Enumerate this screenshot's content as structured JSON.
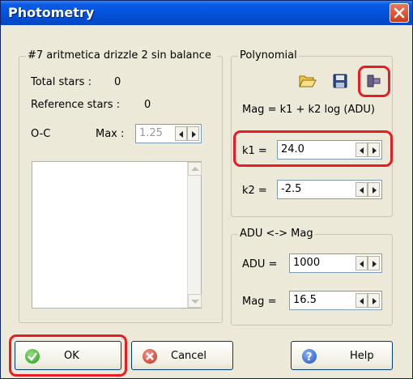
{
  "window": {
    "title": "Photometry"
  },
  "left_group": {
    "title": "#7 aritmetica drizzle 2 sin balance",
    "total_stars_label": "Total stars :",
    "total_stars_value": "0",
    "reference_stars_label": "Reference stars :",
    "reference_stars_value": "0",
    "oc_label": "O-C",
    "max_label": "Max :",
    "max_value": "1.25"
  },
  "polynomial": {
    "title": "Polynomial",
    "formula": "Mag = k1 + k2 log (ADU)",
    "k1_label": "k1 =",
    "k1_value": "24.0",
    "k2_label": "k2 =",
    "k2_value": "-2.5",
    "icons": [
      "open-folder-icon",
      "save-disk-icon",
      "apply-icon"
    ]
  },
  "adu_mag": {
    "title": "ADU <-> Mag",
    "adu_label": "ADU =",
    "adu_value": "1000",
    "mag_label": "Mag =",
    "mag_value": "16.5"
  },
  "buttons": {
    "ok": "OK",
    "cancel": "Cancel",
    "help": "Help"
  },
  "colors": {
    "titlebar": "#0350d8",
    "highlight": "#e81c24",
    "dialog": "#ece9d8"
  }
}
